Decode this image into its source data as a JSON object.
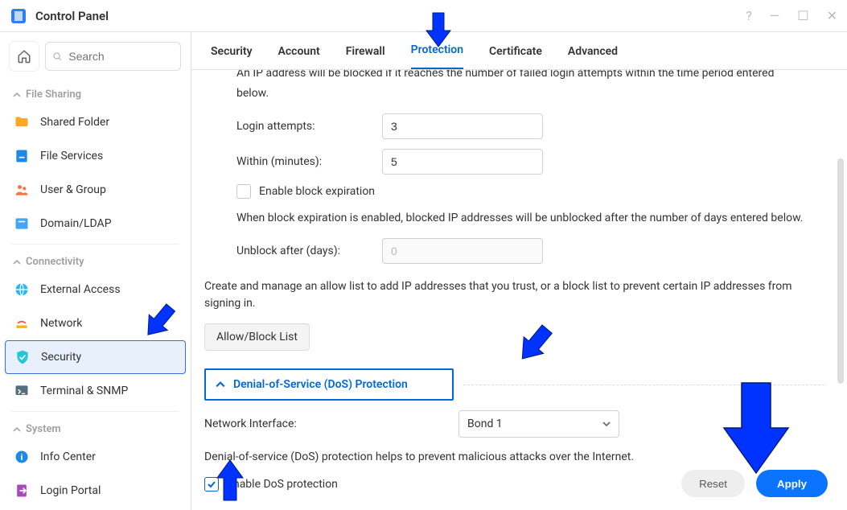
{
  "window": {
    "title": "Control Panel"
  },
  "search": {
    "placeholder": "Search"
  },
  "sidebar": {
    "sections": [
      {
        "name": "File Sharing",
        "items": [
          {
            "label": "Shared Folder"
          },
          {
            "label": "File Services"
          },
          {
            "label": "User & Group"
          },
          {
            "label": "Domain/LDAP"
          }
        ]
      },
      {
        "name": "Connectivity",
        "items": [
          {
            "label": "External Access"
          },
          {
            "label": "Network"
          },
          {
            "label": "Security",
            "active": true
          },
          {
            "label": "Terminal & SNMP"
          }
        ]
      },
      {
        "name": "System",
        "items": [
          {
            "label": "Info Center"
          },
          {
            "label": "Login Portal"
          }
        ]
      }
    ]
  },
  "tabs": [
    "Security",
    "Account",
    "Firewall",
    "Protection",
    "Certificate",
    "Advanced"
  ],
  "active_tab": "Protection",
  "protection": {
    "clipped_text": "An IP address will be blocked if it reaches the number of failed login attempts within the time period entered",
    "below": "below.",
    "login_attempts_label": "Login attempts:",
    "login_attempts_value": "3",
    "within_label": "Within (minutes):",
    "within_value": "5",
    "enable_block_exp_label": "Enable block expiration",
    "block_exp_desc": "When block expiration is enabled, blocked IP addresses will be unblocked after the number of days entered below.",
    "unblock_label": "Unblock after (days):",
    "unblock_value": "0",
    "allow_block_desc": "Create and manage an allow list to add IP addresses that you trust, or a block list to prevent certain IP addresses from signing in.",
    "allow_block_btn": "Allow/Block List",
    "dos_header": "Denial-of-Service (DoS) Protection",
    "net_if_label": "Network Interface:",
    "net_if_value": "Bond 1",
    "dos_desc": "Denial-of-service (DoS) protection helps to prevent malicious attacks over the Internet.",
    "enable_dos_label": "Enable DoS protection"
  },
  "footer": {
    "reset": "Reset",
    "apply": "Apply"
  }
}
